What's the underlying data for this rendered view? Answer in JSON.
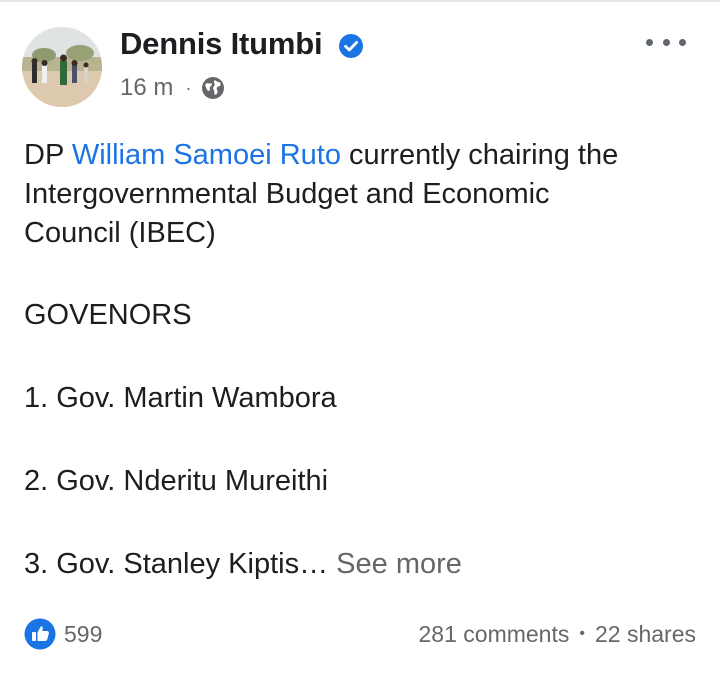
{
  "post": {
    "author": "Dennis Itumbi",
    "time": "16 m",
    "meta_separator": "·",
    "text": {
      "line1_prefix": "DP ",
      "mention": "William Samoei Ruto",
      "line1_suffix": " currently chairing the",
      "line2": "Intergovernmental Budget and Economic",
      "line3": "Council (IBEC)",
      "heading": " GOVENORS",
      "item1": "1. Gov. Martin Wambora",
      "item2": "2. Gov. Nderitu Mureithi",
      "item3": "3. Gov. Stanley Kiptis…",
      "see_more": "See more"
    }
  },
  "engagement": {
    "reaction_count": "599",
    "comments": "281 comments",
    "separator": "•",
    "shares": "22 shares"
  },
  "colors": {
    "link": "#1b74e4",
    "secondary_text": "#65676b",
    "verified_badge": "#1b74e4",
    "like_badge": "#1b74e4"
  },
  "icons": {
    "verified": "verified-badge-icon",
    "globe": "globe-icon",
    "more": "more-options-icon",
    "like": "like-thumb-icon"
  }
}
